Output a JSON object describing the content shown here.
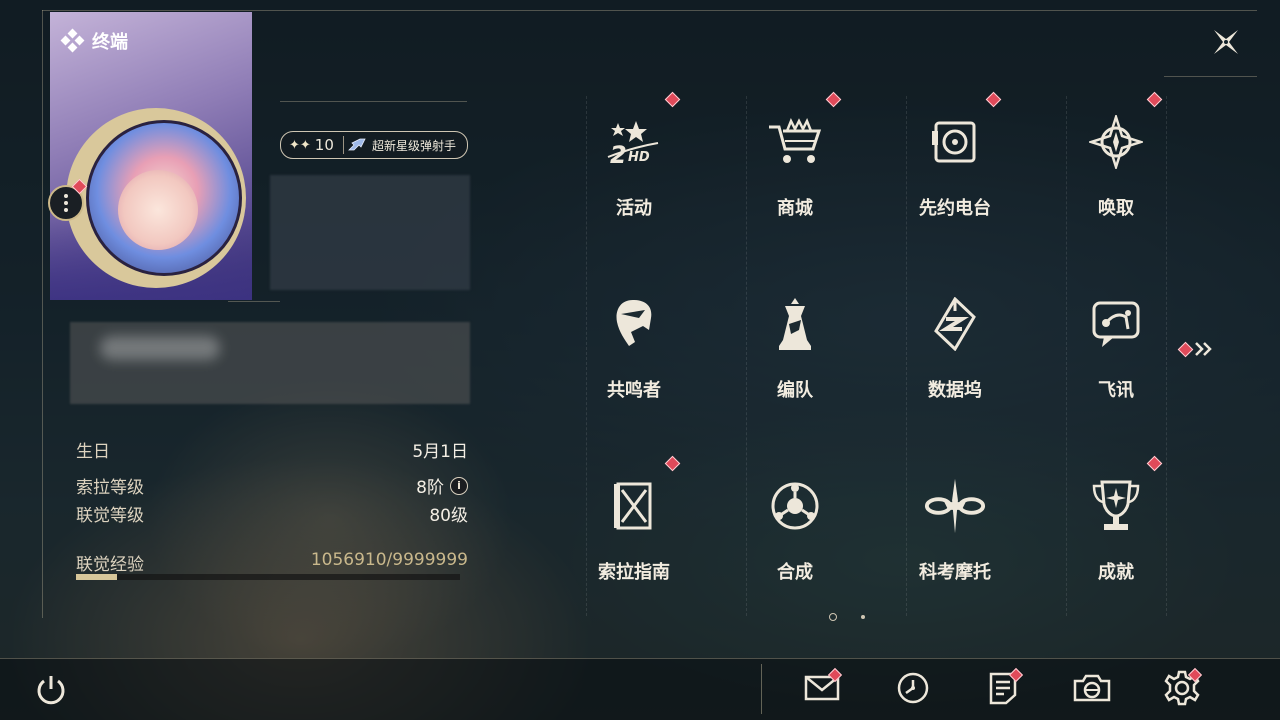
{
  "card": {
    "title": "终端",
    "title_icon": "diamond-cluster-icon"
  },
  "rank": {
    "level": "10",
    "name": "超新星级弹射手",
    "level_icon": "sparkle-icon",
    "name_icon": "rocket-icon"
  },
  "info": {
    "birthday_label": "生日",
    "birthday_value": "5月1日",
    "sola_label": "索拉等级",
    "sola_value": "8阶",
    "sola_info_icon": "i",
    "union_label": "联觉等级",
    "union_value": "80级",
    "exp_label": "联觉经验",
    "exp_value": "1056910/9999999",
    "exp_progress": 0.106
  },
  "menu": [
    {
      "label": "活动",
      "icon": "event-2hd-icon",
      "badge": true
    },
    {
      "label": "商城",
      "icon": "shop-cart-icon",
      "badge": true
    },
    {
      "label": "先约电台",
      "icon": "radio-icon",
      "badge": true
    },
    {
      "label": "唤取",
      "icon": "summon-compass-icon",
      "badge": true
    },
    {
      "label": "共鸣者",
      "icon": "resonator-icon",
      "badge": false
    },
    {
      "label": "编队",
      "icon": "team-chess-icon",
      "badge": false
    },
    {
      "label": "数据坞",
      "icon": "databank-icon",
      "badge": false
    },
    {
      "label": "飞讯",
      "icon": "message-icon",
      "badge": false
    },
    {
      "label": "索拉指南",
      "icon": "guide-book-icon",
      "badge": true
    },
    {
      "label": "合成",
      "icon": "synthesis-icon",
      "badge": false
    },
    {
      "label": "科考摩托",
      "icon": "motorcycle-icon",
      "badge": false
    },
    {
      "label": "成就",
      "icon": "trophy-icon",
      "badge": true
    }
  ],
  "pagination": {
    "current": 1,
    "total": 2
  },
  "bottom": [
    {
      "name": "mail",
      "icon": "mail-icon",
      "badge": true
    },
    {
      "name": "clock",
      "icon": "clock-icon",
      "badge": false
    },
    {
      "name": "notes",
      "icon": "notes-icon",
      "badge": true
    },
    {
      "name": "camera",
      "icon": "camera-icon",
      "badge": false
    },
    {
      "name": "settings",
      "icon": "gear-icon",
      "badge": true
    }
  ],
  "colors": {
    "accent": "#d9c89b",
    "badge": "#e04a5a",
    "text": "#ede7da"
  }
}
